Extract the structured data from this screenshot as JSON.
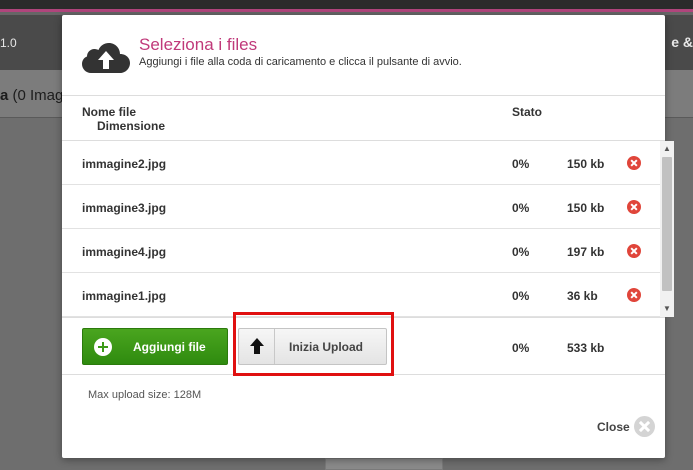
{
  "background": {
    "version_text": "1.0",
    "right_text": "e &",
    "label_prefix": "a",
    "label_count": " (0 Imag"
  },
  "modal": {
    "title": "Seleziona i files",
    "subtitle": "Aggiungi i file alla coda di caricamento e clicca il pulsante di avvio.",
    "columns": {
      "name": "Nome file",
      "size": "Dimensione",
      "status": "Stato"
    },
    "files": [
      {
        "name": "immagine2.jpg",
        "status": "0%",
        "size": "150 kb"
      },
      {
        "name": "immagine3.jpg",
        "status": "0%",
        "size": "150 kb"
      },
      {
        "name": "immagine4.jpg",
        "status": "0%",
        "size": "197 kb"
      },
      {
        "name": "immagine1.jpg",
        "status": "0%",
        "size": "36 kb"
      }
    ],
    "footer": {
      "add_label": "Aggiungi file",
      "upload_label": "Inizia Upload",
      "total_status": "0%",
      "total_size": "533 kb"
    },
    "max_upload": "Max upload size: 128M",
    "close_label": "Close"
  },
  "colors": {
    "accent": "#c0397a",
    "add_button": "#3c9a18",
    "highlight": "#e01010",
    "remove": "#e0453a"
  }
}
